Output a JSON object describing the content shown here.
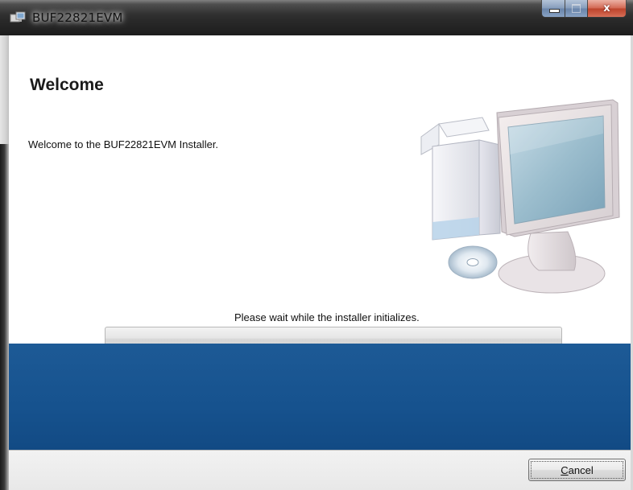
{
  "window": {
    "title": "BUF22821EVM",
    "controls": {
      "minimize": "minimize",
      "maximize": "maximize",
      "close": "x"
    }
  },
  "page": {
    "heading": "Welcome",
    "intro": "Welcome to the BUF22821EVM Installer.",
    "status": "Please wait while the installer initializes.",
    "progress": 0
  },
  "footer": {
    "cancel_accelerator": "C",
    "cancel_rest": "ancel"
  },
  "icons": {
    "app": "installer-window-icon",
    "illustration": "computer-install-icon"
  },
  "colors": {
    "banner": "#16528e",
    "content_background": "#ffffff",
    "close_button": "#c8462e"
  }
}
